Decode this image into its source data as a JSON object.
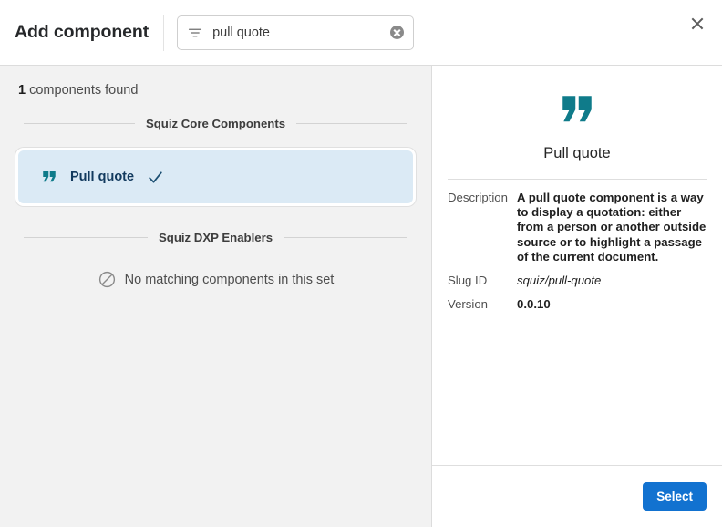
{
  "header": {
    "title": "Add component",
    "search": {
      "value": "pull quote",
      "placeholder": "Filter components",
      "filter_icon": "filter-icon",
      "clear_icon": "clear-circle-icon"
    },
    "close_icon": "close-icon"
  },
  "left": {
    "count_number": "1",
    "count_label": " components found",
    "sections": [
      {
        "label": "Squiz Core Components",
        "empty_message": null,
        "items": [
          {
            "label": "Pull quote",
            "icon": "quote-icon",
            "selected": true,
            "check_icon": "check-icon"
          }
        ]
      },
      {
        "label": "Squiz DXP Enablers",
        "empty_message": "No matching components in this set",
        "empty_icon": "no-entry-icon",
        "items": []
      }
    ]
  },
  "detail": {
    "icon": "quote-icon",
    "title": "Pull quote",
    "fields": [
      {
        "key": "Description",
        "value": "A pull quote component is a way to display a quotation: either from a person or another outside source or to highlight a passage of the current document.",
        "style": "bold"
      },
      {
        "key": "Slug ID",
        "value": "squiz/pull-quote",
        "style": "italic"
      },
      {
        "key": "Version",
        "value": "0.0.10",
        "style": "bold"
      }
    ]
  },
  "footer": {
    "select_label": "Select"
  },
  "colors": {
    "accent_teal": "#0f7b8a",
    "primary_blue": "#1272d0",
    "card_selected_bg": "#dbeaf5",
    "card_label": "#123a5e",
    "panel_bg": "#f2f2f2"
  }
}
